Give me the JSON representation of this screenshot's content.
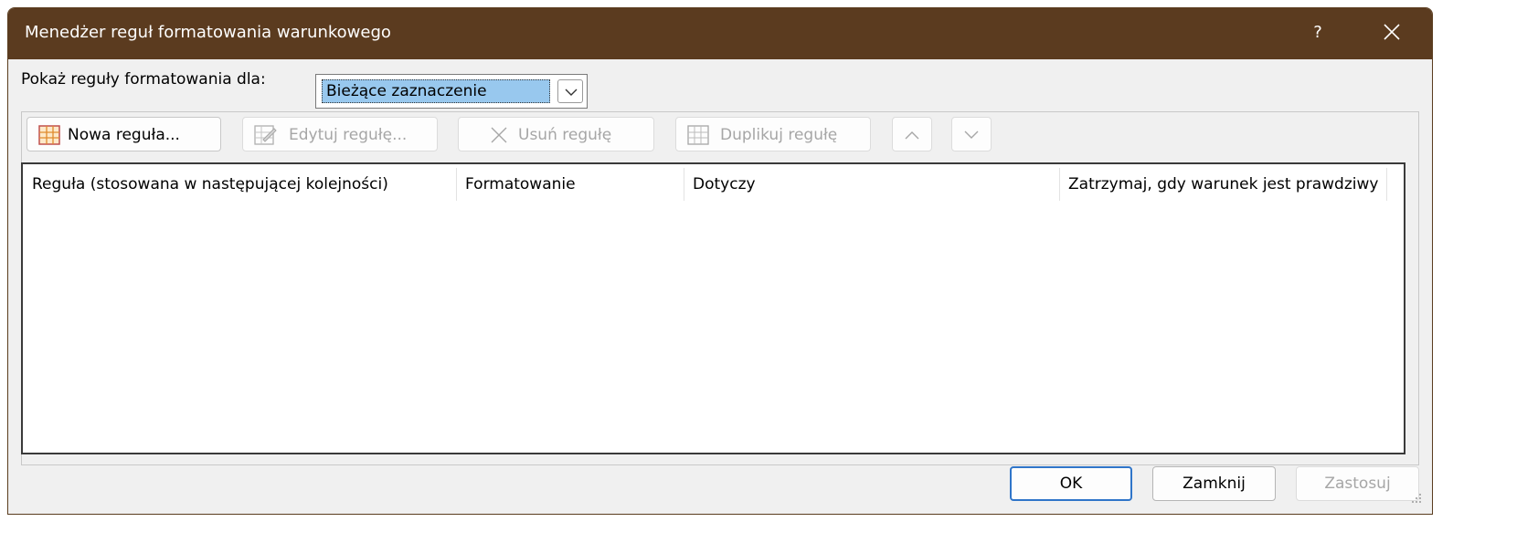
{
  "dialog": {
    "title": "Menedżer reguł formatowania warunkowego",
    "help_label": "?",
    "close_icon": "close-icon"
  },
  "filter": {
    "label": "Pokaż reguły formatowania dla:",
    "selected_value": "Bieżące zaznaczenie"
  },
  "toolbar": {
    "new_rule": "Nowa reguła...",
    "edit_rule": "Edytuj regułę...",
    "delete_rule": "Usuń regułę",
    "duplicate_rule": "Duplikuj regułę",
    "move_up_icon": "chevron-up-icon",
    "move_down_icon": "chevron-down-icon"
  },
  "rules_table": {
    "columns": [
      "Reguła (stosowana w następującej kolejności)",
      "Formatowanie",
      "Dotyczy",
      "Zatrzymaj, gdy warunek jest prawdziwy"
    ],
    "rows": []
  },
  "footer": {
    "ok": "OK",
    "close": "Zamknij",
    "apply": "Zastosuj"
  },
  "colors": {
    "titlebar": "#5b3b1f",
    "accent": "#2f75c9",
    "selection": "#98c8ee"
  }
}
